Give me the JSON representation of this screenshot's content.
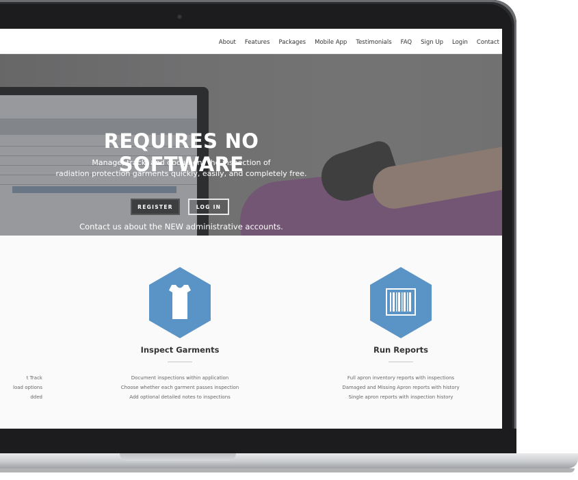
{
  "nav": {
    "items": [
      "About",
      "Features",
      "Packages",
      "Mobile App",
      "Testimonials",
      "FAQ",
      "Sign Up",
      "Login",
      "Contact"
    ]
  },
  "hero": {
    "title": "REQUIRES NO SOFTWARE",
    "subtitle_line1": "Manage, track, and document the inspection of",
    "subtitle_line2": "radiation protection garments quickly, easily, and completely free.",
    "register_label": "REGISTER",
    "login_label": "LOG IN",
    "note": "Contact us about the NEW administrative accounts."
  },
  "features": {
    "track": {
      "lines": [
        "t Track",
        "load options",
        "dded"
      ]
    },
    "inspect": {
      "icon": "garment-icon",
      "title": "Inspect Garments",
      "lines": [
        "Document inspections within application",
        "Choose whether each garment passes inspection",
        "Add optional detailed notes to inspections"
      ]
    },
    "reports": {
      "icon": "barcode-icon",
      "title": "Run Reports",
      "lines": [
        "Full apron inventory reports with inspections",
        "Damaged and Missing Apron reports with history",
        "Single apron reports with inspection history"
      ]
    }
  },
  "colors": {
    "accent_hex": "#5a93c6",
    "button_dark": "#3d3e40",
    "laptop_bezel": "#1c1c1e"
  }
}
